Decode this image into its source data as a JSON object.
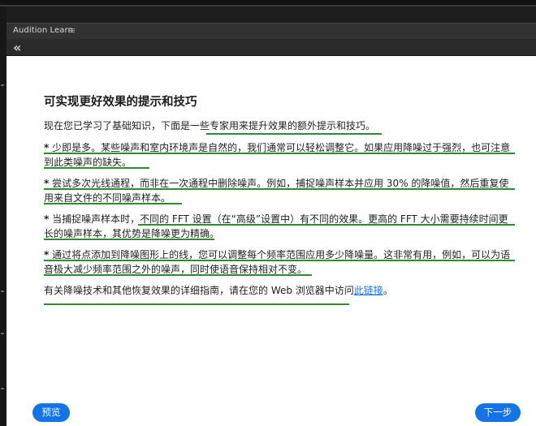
{
  "panel": {
    "title": "Audition Learn",
    "menu_icon": "≡",
    "back_icon": "«"
  },
  "page_title": "可实现更好效果的提示和技巧",
  "intro": "现在您已学习了基础知识，下面是一些专家用来提升效果的额外提示和技巧。",
  "tips": [
    {
      "bullet": "*",
      "text": "少即是多。某些噪声和室内环境声是自然的，我们通常可以轻松调整它。如果应用降噪过于强烈，也可注意到此类噪声的缺失。"
    },
    {
      "bullet": "*",
      "text": "尝试多次光线通程，而非在一次通程中删除噪声。例如，捕捉噪声样本并应用 30% 的降噪值，然后重复使用来自文件的不同噪声样本。"
    },
    {
      "bullet": "*",
      "text": "当捕捉噪声样本时，不同的 FFT 设置（在“高级”设置中）有不同的效果。更高的 FFT 大小需要持续时间更长的噪声样本，其优势是降噪更为精确。"
    },
    {
      "bullet": "*",
      "text": "通过将点添加到降噪图形上的线，您可以调整每个频率范围应用多少降噪量。这非常有用，例如，可以为语音极大减少频率范围之外的噪声，同时使语音保持相对不变。"
    }
  ],
  "footer": {
    "text": "有关降噪技术和其他恢复效果的详细指南，请在您的 Web 浏览器中访问",
    "link": "此链接",
    "end": "。"
  },
  "buttons": {
    "prev": "预览",
    "next": "下一步"
  },
  "colors": {
    "accent": "#1473e6",
    "annotation": "#2e8b2e"
  }
}
